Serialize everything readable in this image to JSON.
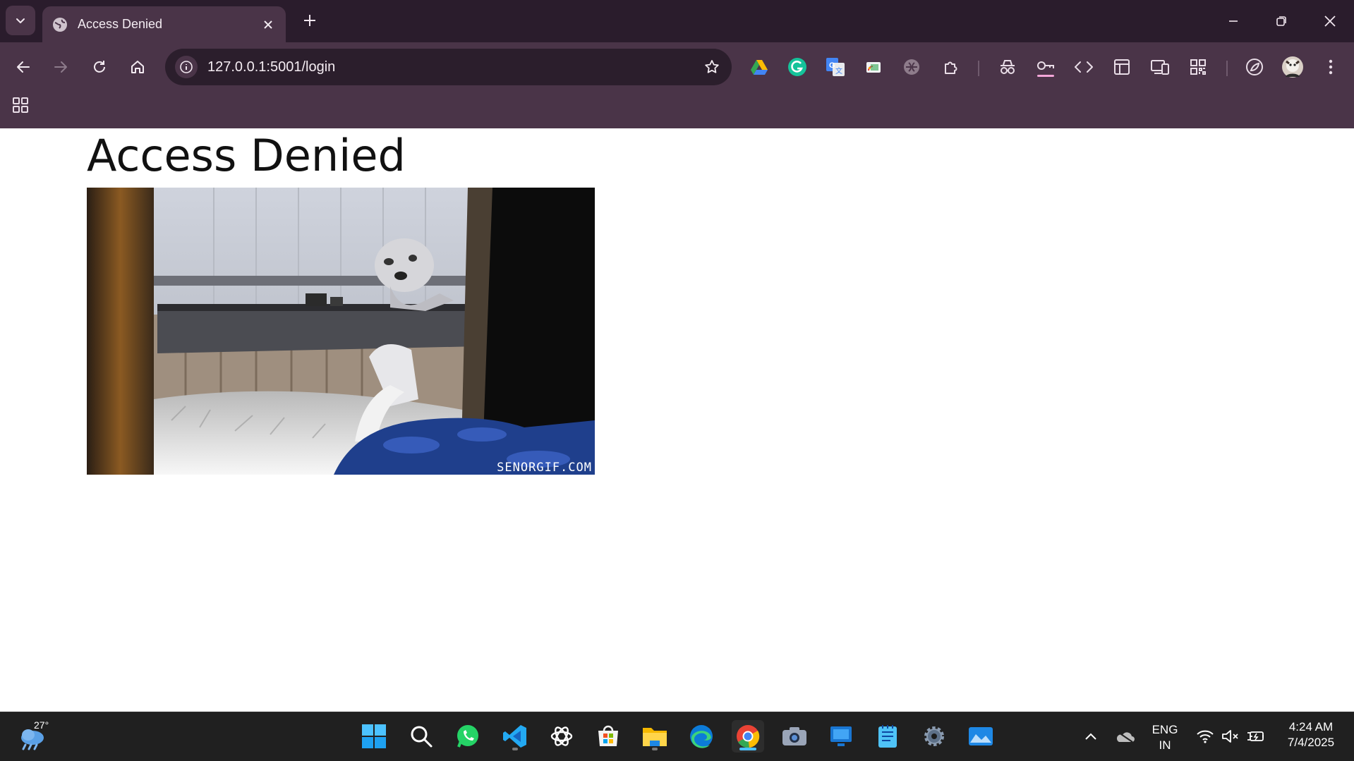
{
  "browser": {
    "tab": {
      "title": "Access Denied"
    },
    "address_bar": {
      "url": "127.0.0.1:5001/login"
    }
  },
  "page": {
    "heading": "Access Denied",
    "gif": {
      "watermark": "SENORGIF.COM"
    }
  },
  "taskbar": {
    "weather": {
      "temp": "27°"
    },
    "tray": {
      "lang_line1": "ENG",
      "lang_line2": "IN",
      "time": "4:24 AM",
      "date": "7/4/2025"
    }
  }
}
